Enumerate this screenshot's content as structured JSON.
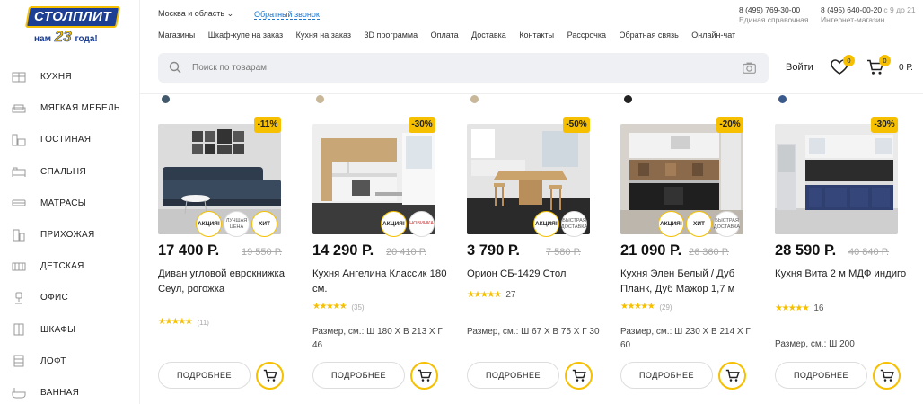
{
  "logo": {
    "brand": "СТОЛПЛИТ",
    "tagline_pre": "нам",
    "years": "23",
    "tagline_post": "года!"
  },
  "sidebar": {
    "items": [
      {
        "label": "КУХНЯ",
        "icon": "kitchen-icon"
      },
      {
        "label": "МЯГКАЯ МЕБЕЛЬ",
        "icon": "sofa-icon"
      },
      {
        "label": "ГОСТИНАЯ",
        "icon": "living-room-icon"
      },
      {
        "label": "СПАЛЬНЯ",
        "icon": "bed-icon"
      },
      {
        "label": "МАТРАСЫ",
        "icon": "mattress-icon"
      },
      {
        "label": "ПРИХОЖАЯ",
        "icon": "hallway-icon"
      },
      {
        "label": "ДЕТСКАЯ",
        "icon": "crib-icon"
      },
      {
        "label": "ОФИС",
        "icon": "office-chair-icon"
      },
      {
        "label": "ШКАФЫ",
        "icon": "wardrobe-icon"
      },
      {
        "label": "ЛОФТ",
        "icon": "loft-icon"
      },
      {
        "label": "ВАННАЯ",
        "icon": "bathroom-icon"
      }
    ]
  },
  "header": {
    "region": "Москва и область",
    "callback": "Обратный звонок",
    "phone1": {
      "number": "8 (499) 769-30-00",
      "label": "Единая справочная"
    },
    "phone2": {
      "number": "8 (495) 640-00-20",
      "hours": "с 9 до 21",
      "label": "Интернет-магазин"
    },
    "nav": [
      "Магазины",
      "Шкаф-купе на заказ",
      "Кухня на заказ",
      "3D программа",
      "Оплата",
      "Доставка",
      "Контакты",
      "Рассрочка",
      "Обратная связь",
      "Онлайн-чат"
    ],
    "search_placeholder": "Поиск по товарам",
    "login": "Войти",
    "fav_count": "0",
    "cart_count": "0",
    "cart_sum": "0 Р."
  },
  "colors": {
    "accent": "#f6c000",
    "brand_blue": "#1c3f94",
    "link": "#1976d2"
  },
  "buttons": {
    "more": "ПОДРОБНЕЕ"
  },
  "products": [
    {
      "swatch": "#41596b",
      "discount": "-11%",
      "tags": [
        "АКЦИЯ!",
        "ЛУЧШАЯ ЦЕНА",
        "ХИТ"
      ],
      "price": "17 400 Р.",
      "old_price": "19 550 Р.",
      "name": "Диван угловой еврокнижка Сеул, рогожка",
      "stars": "★★★★★",
      "reviews": "(11)",
      "size": ""
    },
    {
      "swatch": "#c9b79a",
      "discount": "-30%",
      "tags": [
        "АКЦИЯ!",
        "НОВИНКА"
      ],
      "price": "14 290 Р.",
      "old_price": "20 410 Р.",
      "name": "Кухня Ангелина Классик 180 см.",
      "stars": "★★★★★",
      "reviews": "(35)",
      "size": "Размер, см.: Ш 180 Х В 213 Х Г 46"
    },
    {
      "swatch": "#c9b79a",
      "discount": "-50%",
      "tags": [
        "АКЦИЯ!",
        "БЫСТРАЯ ДОСТАВКА"
      ],
      "price": "3 790 Р.",
      "old_price": "7 580 Р.",
      "name": "Орион СБ-1429 Стол",
      "stars": "★★★★★",
      "reviews": "27",
      "size": "Размер, см.: Ш 67 Х В 75 Х Г 30"
    },
    {
      "swatch": "#222222",
      "discount": "-20%",
      "tags": [
        "АКЦИЯ!",
        "ХИТ",
        "БЫСТРАЯ ДОСТАВКА"
      ],
      "price": "21 090 Р.",
      "old_price": "26 360 Р.",
      "name": "Кухня Элен Белый / Дуб Планк, Дуб Мажор 1,7 м",
      "stars": "★★★★★",
      "reviews": "(29)",
      "size": "Размер, см.: Ш 230 Х В 214 Х Г 60"
    },
    {
      "swatch": "#3b5a8c",
      "discount": "-30%",
      "tags": [],
      "price": "28 590 Р.",
      "old_price": "40 840 Р.",
      "name": "Кухня Вита 2 м МДФ индиго",
      "stars": "★★★★★",
      "reviews": "16",
      "size": "Размер, см.: Ш 200"
    }
  ]
}
